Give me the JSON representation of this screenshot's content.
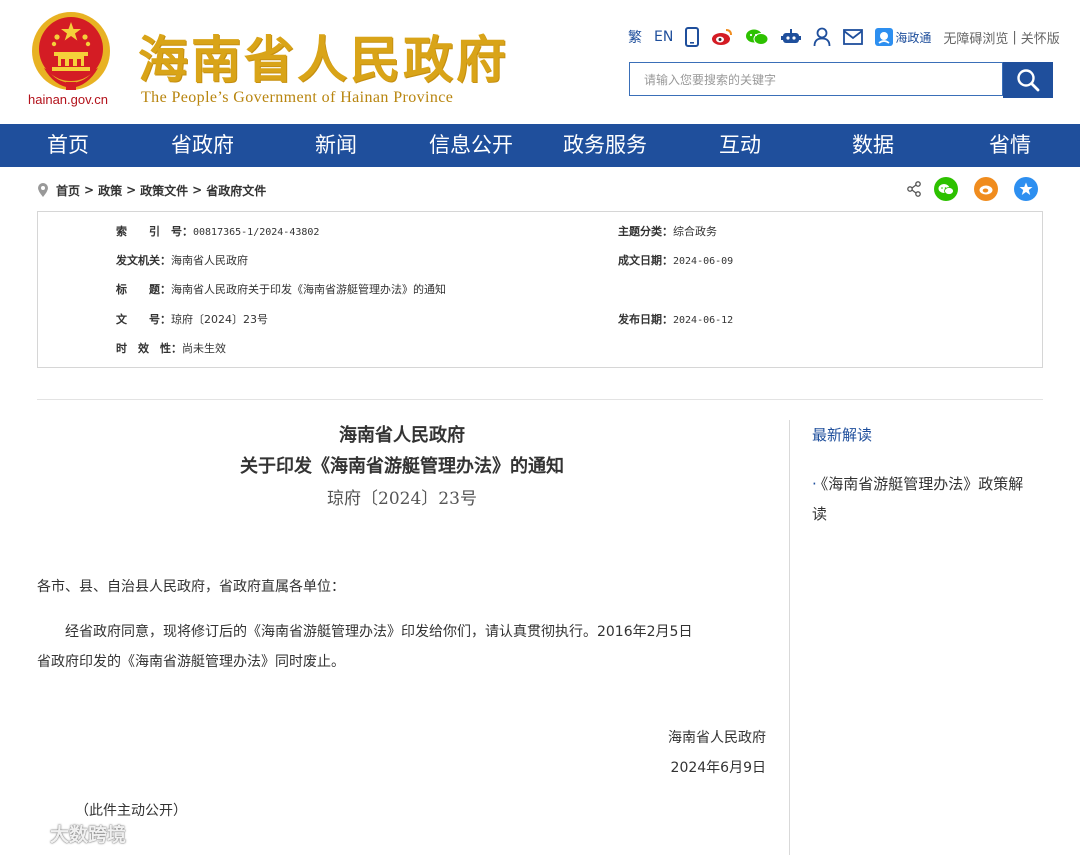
{
  "header": {
    "domain": "hainan.gov.cn",
    "title": "海南省人民政府",
    "subtitle": "The People’s Government  of Hainan Province",
    "toolbar": {
      "traditional": "繁",
      "english": "EN",
      "haizhengtong": "海政通",
      "accessible": "无障碍浏览",
      "sep": "|",
      "care": "关怀版"
    },
    "search": {
      "placeholder": "请输入您要搜索的关键字"
    }
  },
  "nav": {
    "items": [
      "首页",
      "省政府",
      "新闻",
      "信息公开",
      "政务服务",
      "互动",
      "数据",
      "省情"
    ]
  },
  "breadcrumb": {
    "items": [
      "首页",
      "政策",
      "政策文件",
      "省政府文件"
    ],
    "sep": ">"
  },
  "meta": {
    "index_label": "索　　引　号：",
    "index_value": "00817365-1/2024-43802",
    "topic_label": "主题分类：",
    "topic_value": "综合政务",
    "issuer_label": "发文机关：",
    "issuer_value": "海南省人民政府",
    "created_label": "成文日期：",
    "created_value": "2024-06-09",
    "title_label": "标　　题：",
    "title_value": "海南省人民政府关于印发《海南省游艇管理办法》的通知",
    "docno_label": "文　　号：",
    "docno_value": "琼府〔2024〕23号",
    "published_label": "发布日期：",
    "published_value": "2024-06-12",
    "validity_label": "时　效　性：",
    "validity_value": "尚未生效"
  },
  "article": {
    "issuer": "海南省人民政府",
    "title": "关于印发《海南省游艇管理办法》的通知",
    "doc_number": "琼府〔2024〕23号",
    "salutation": "各市、县、自治县人民政府，省政府直属各单位：",
    "body_line1": "经省政府同意，现将修订后的《海南省游艇管理办法》印发给你们，请认真贯彻执行。2016年2月5日",
    "body_line2": "省政府印发的《海南省游艇管理办法》同时废止。",
    "signature": "海南省人民政府",
    "date": "2024年6月9日",
    "note": "（此件主动公开）"
  },
  "sidebar": {
    "title": "最新解读",
    "items": [
      {
        "line1": "《海南省游艇管理办法》政策解",
        "line2": "读",
        "bullet": "·"
      }
    ]
  },
  "watermark": {
    "text": "大数跨境"
  },
  "colors": {
    "primary": "#1f4f9c",
    "gold": "#d9a418",
    "red": "#d41c24",
    "wechat": "#2dc100",
    "weibo": "#f08c1e",
    "favorite": "#2d8ff0"
  }
}
